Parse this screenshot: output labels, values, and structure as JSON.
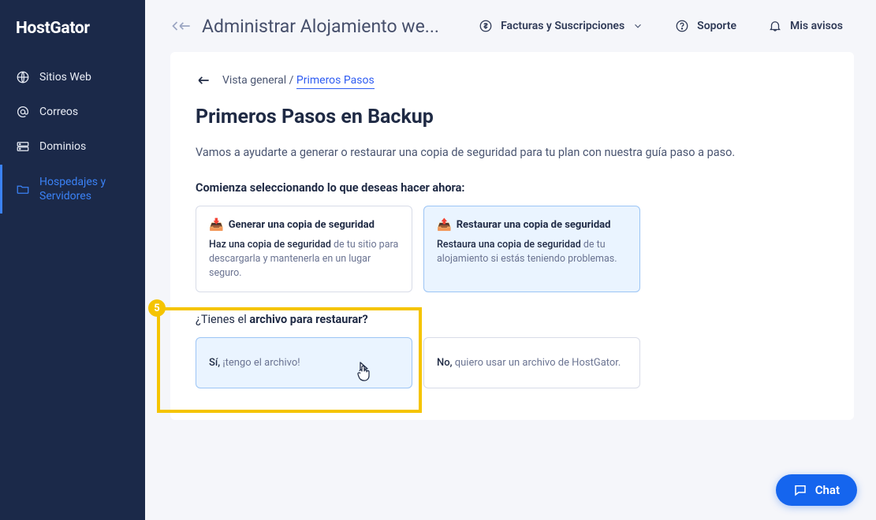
{
  "brand": "HostGator",
  "sidebar": {
    "items": [
      {
        "label": "Sitios Web"
      },
      {
        "label": "Correos"
      },
      {
        "label": "Dominios"
      },
      {
        "label": "Hospedajes y Servidores"
      }
    ]
  },
  "header": {
    "title": "Administrar Alojamiento we...",
    "links": {
      "billing": "Facturas y Suscripciones",
      "support": "Soporte",
      "notices": "Mis avisos"
    }
  },
  "breadcrumb": {
    "root": "Vista general",
    "sep": " / ",
    "current": "Primeros Pasos"
  },
  "page": {
    "title": "Primeros Pasos en Backup",
    "subtitle": "Vamos a ayudarte a generar o restaurar una copia de seguridad para tu plan con nuestra guía paso a paso.",
    "section1_label": "Comienza seleccionando lo que deseas hacer ahora:",
    "cards": [
      {
        "emoji": "📥",
        "title": "Generar una copia de seguridad",
        "desc_strong": "Haz una copia de seguridad",
        "desc_rest": " de tu sitio para descargarla y mantenerla en un lugar seguro."
      },
      {
        "emoji": "📤",
        "title": "Restaurar una copia de seguridad",
        "desc_strong": "Restaura una copia de seguridad",
        "desc_rest": " de tu alojamiento si estás teniendo problemas."
      }
    ],
    "section2_label_light": "¿Tienes el ",
    "section2_label_strong": "archivo para restaurar?",
    "answers": [
      {
        "strong": "Sí,",
        "rest": " ¡tengo el archivo!"
      },
      {
        "strong": "No,",
        "rest": " quiero usar un archivo de HostGator."
      }
    ]
  },
  "tour": {
    "step": "5"
  },
  "chat": {
    "label": "Chat"
  }
}
